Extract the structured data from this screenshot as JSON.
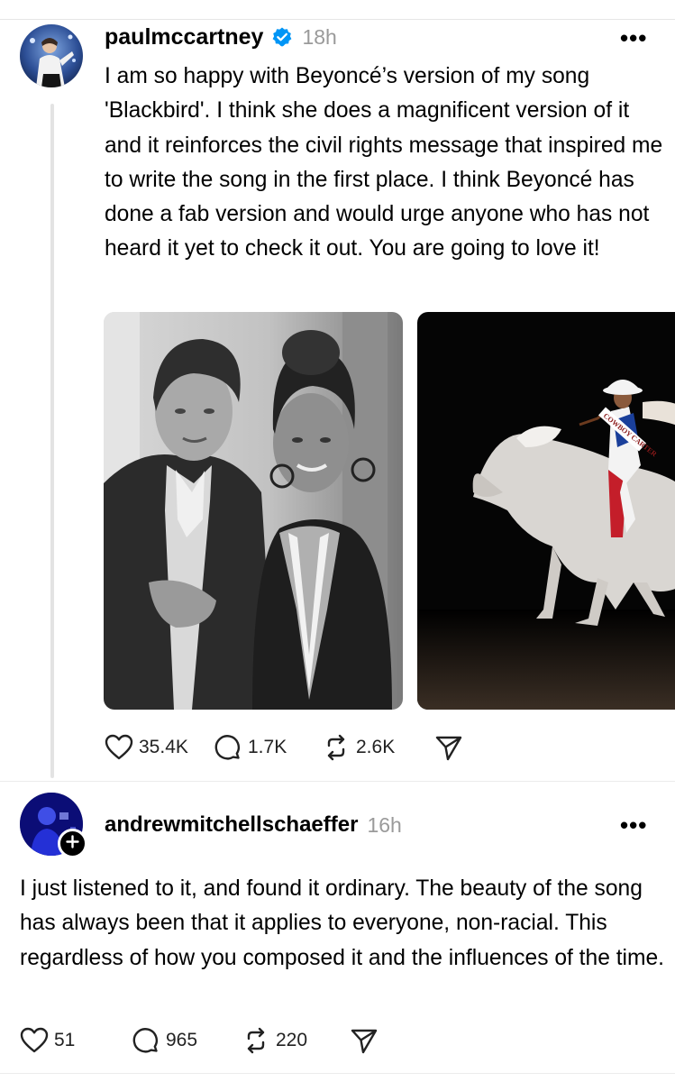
{
  "post": {
    "username": "paulmccartney",
    "verified_icon": "verified-badge-icon",
    "time": "18h",
    "more_icon": "•••",
    "body": "I am so happy with Beyoncé’s version of my song 'Blackbird'. I think she does a magnificent version of it and it reinforces the civil rights message that inspired me to write the song in the first place. I think Beyoncé has done a fab version and would urge anyone who has not heard it yet to check it out. You are going to love it!",
    "images": [
      {
        "alt": "Black and white photo of Paul McCartney and Beyoncé"
      },
      {
        "alt": "Cowboy Carter album art: Beyoncé riding a white horse",
        "sash_text": "COWBOY CARTER"
      }
    ],
    "likes": "35.4K",
    "replies": "1.7K",
    "reposts": "2.6K"
  },
  "reply": {
    "username": "andrewmitchellschaeffer",
    "time": "16h",
    "more_icon": "•••",
    "body": "I just listened to it, and found it ordinary.  The beauty of the song has always been that it applies to everyone, non-racial.  This regardless of how you composed it and the influences of the time.",
    "likes": "51",
    "replies": "965",
    "reposts": "220"
  },
  "colors": {
    "verified_blue": "#0095f6",
    "muted_text": "#9a9a9a",
    "divider": "#ececec"
  }
}
